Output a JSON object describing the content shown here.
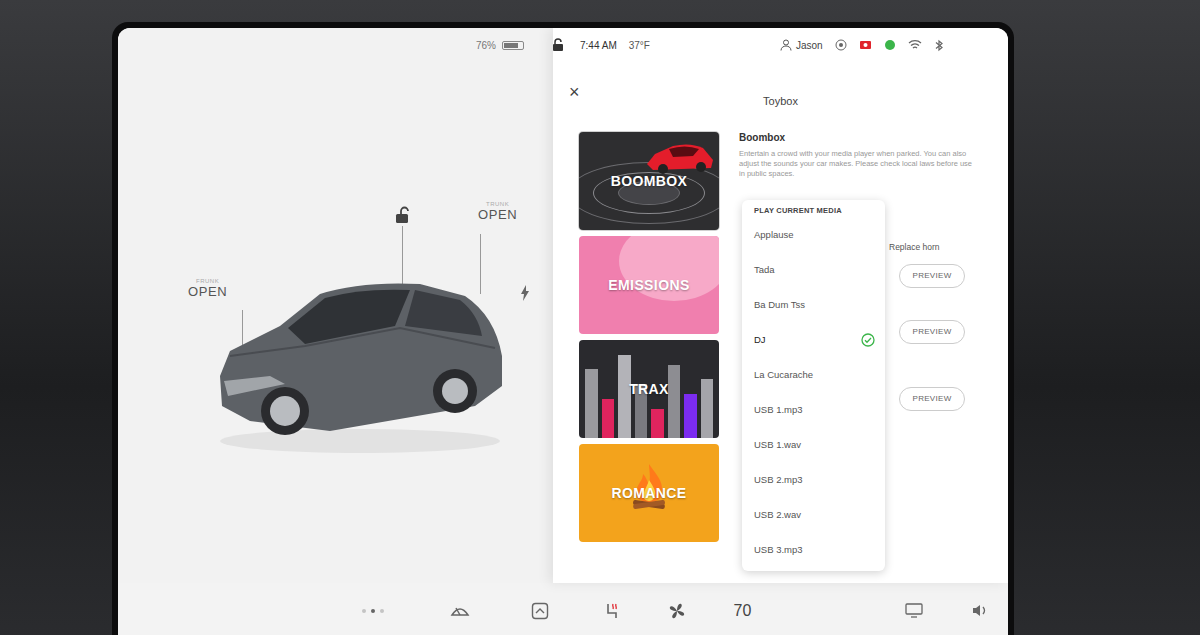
{
  "status_bar": {
    "battery": "76%",
    "battery_level": 0.76,
    "time": "7:44 AM",
    "temperature": "37°F",
    "user": "Jason"
  },
  "car": {
    "locked": false,
    "charging": true,
    "callouts": [
      {
        "name": "FRUNK",
        "state": "OPEN",
        "kind": "frunk"
      },
      {
        "name": "TRUNK",
        "state": "OPEN",
        "kind": "trunk"
      }
    ]
  },
  "toybox": {
    "close": "×",
    "title": "Toybox",
    "cards": [
      {
        "label": "BOOMBOX",
        "selected": true,
        "color": "#2e2e30",
        "kind": "boombox"
      },
      {
        "label": "EMISSIONS",
        "selected": false,
        "color": "#f07fae",
        "kind": "emissions"
      },
      {
        "label": "TRAX",
        "selected": false,
        "color": "#2a2a2e",
        "kind": "trax"
      },
      {
        "label": "ROMANCE",
        "selected": false,
        "color": "#f3a31c",
        "kind": "romance"
      }
    ],
    "detail": {
      "title": "Boombox",
      "description": "Entertain a crowd with your media player when parked. You can also adjust the sounds your car makes. Please check local laws before use in public spaces.",
      "rows": [
        {
          "label": "Replace horn",
          "button": "PREVIEW"
        },
        {
          "button": "PREVIEW"
        },
        {
          "button": "PREVIEW"
        }
      ]
    },
    "dropdown": {
      "header": "PLAY CURRENT MEDIA",
      "options": [
        {
          "label": "Applause",
          "selected": false
        },
        {
          "label": "Tada",
          "selected": false
        },
        {
          "label": "Ba Dum Tss",
          "selected": false
        },
        {
          "label": "DJ",
          "selected": true
        },
        {
          "label": "La Cucarache",
          "selected": false
        },
        {
          "label": "USB 1.mp3",
          "selected": false
        },
        {
          "label": "USB 1.wav",
          "selected": false
        },
        {
          "label": "USB 2.mp3",
          "selected": false
        },
        {
          "label": "USB 2.wav",
          "selected": false
        },
        {
          "label": "USB 3.mp3",
          "selected": false
        }
      ]
    }
  },
  "bottom_bar": {
    "page_dots": [
      {
        "selected": false
      },
      {
        "selected": true
      },
      {
        "selected": false
      }
    ],
    "cabin_temperature": "70"
  }
}
